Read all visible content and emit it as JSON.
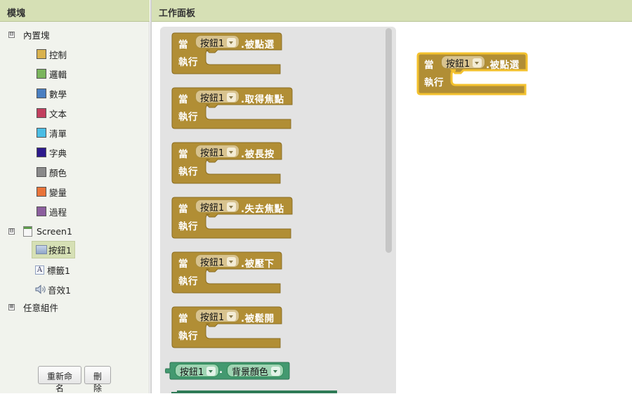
{
  "left_panel": {
    "header": "模塊",
    "builtin": {
      "toggle": "⊟",
      "label": "內置塊",
      "categories": [
        {
          "label": "控制",
          "color": "#d9b24e"
        },
        {
          "label": "邏輯",
          "color": "#7ab55c"
        },
        {
          "label": "數學",
          "color": "#4a7fc1"
        },
        {
          "label": "文本",
          "color": "#c2405f"
        },
        {
          "label": "清單",
          "color": "#4bbde4"
        },
        {
          "label": "字典",
          "color": "#2d1a8c"
        },
        {
          "label": "顏色",
          "color": "#8a8a8a"
        },
        {
          "label": "變量",
          "color": "#e9743a"
        },
        {
          "label": "過程",
          "color": "#8c5f9e"
        }
      ]
    },
    "screen": {
      "toggle": "⊟",
      "label": "Screen1",
      "components": [
        {
          "label": "按鈕1",
          "icon": "button-icon",
          "selected": true
        },
        {
          "label": "標籤1",
          "icon": "label-icon",
          "icon_glyph": "A"
        },
        {
          "label": "音效1",
          "icon": "speaker-icon"
        }
      ]
    },
    "any_component": {
      "toggle": "⊞",
      "label": "任意組件"
    },
    "buttons": {
      "rename": "重新命名",
      "delete": "刪除"
    }
  },
  "right_panel": {
    "header": "工作面板",
    "flyout_blocks": [
      {
        "when": "當",
        "component": "按鈕1",
        "event": ".被點選",
        "do": "執行"
      },
      {
        "when": "當",
        "component": "按鈕1",
        "event": ".取得焦點",
        "do": "執行"
      },
      {
        "when": "當",
        "component": "按鈕1",
        "event": ".被長按",
        "do": "執行"
      },
      {
        "when": "當",
        "component": "按鈕1",
        "event": ".失去焦點",
        "do": "執行"
      },
      {
        "when": "當",
        "component": "按鈕1",
        "event": ".被壓下",
        "do": "執行"
      },
      {
        "when": "當",
        "component": "按鈕1",
        "event": ".被鬆開",
        "do": "執行"
      }
    ],
    "getter_block": {
      "component": "按鈕1",
      "dot": ".",
      "property": "背景顏色"
    },
    "workspace_block": {
      "when": "當",
      "component": "按鈕1",
      "event": ".被點選",
      "do": "執行"
    }
  },
  "colors": {
    "event_block": "#b18e35",
    "getter_block": "#439970",
    "selected_outline": "#f3c12e",
    "header_bg": "#d6e0b5"
  }
}
